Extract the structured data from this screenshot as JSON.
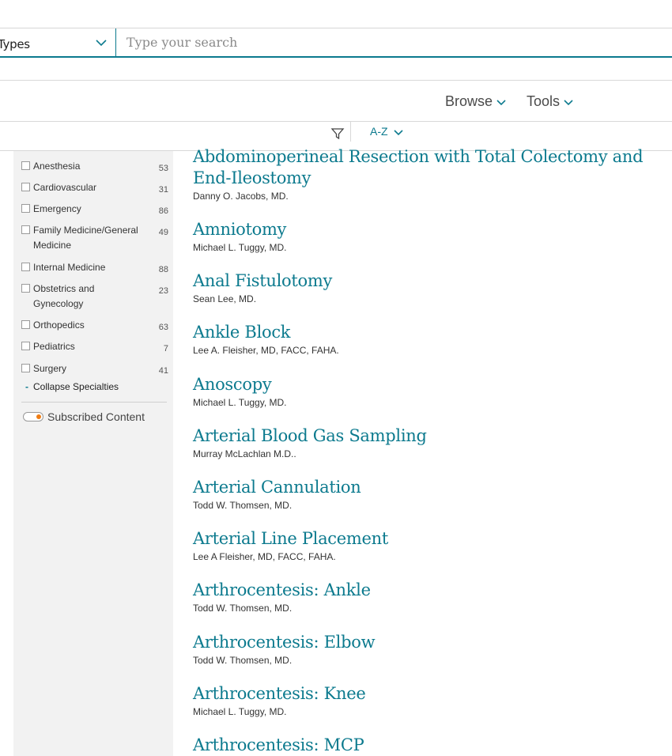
{
  "search": {
    "types_label": "Types",
    "placeholder": "Type your search"
  },
  "nav": {
    "browse": "Browse",
    "tools": "Tools"
  },
  "filter": {
    "sort_label": "A-Z"
  },
  "sidebar": {
    "specialties": [
      {
        "label": "Anesthesia",
        "count": "53"
      },
      {
        "label": "Cardiovascular",
        "count": "31"
      },
      {
        "label": "Emergency",
        "count": "86"
      },
      {
        "label": "Family Medicine/General Medicine",
        "count": "49"
      },
      {
        "label": "Internal Medicine",
        "count": "88"
      },
      {
        "label": "Obstetrics and Gynecology",
        "count": "23"
      },
      {
        "label": "Orthopedics",
        "count": "63"
      },
      {
        "label": "Pediatrics",
        "count": "7"
      },
      {
        "label": "Surgery",
        "count": "41"
      }
    ],
    "collapse_label": "Collapse Specialties",
    "subscribed_label": "Subscribed Content"
  },
  "results": [
    {
      "title": "Abdominoperineal Resection with Total Colectomy and End-Ileostomy",
      "author": "Danny O. Jacobs, MD."
    },
    {
      "title": "Amniotomy",
      "author": "Michael L. Tuggy, MD."
    },
    {
      "title": "Anal Fistulotomy",
      "author": "Sean Lee, MD."
    },
    {
      "title": "Ankle Block",
      "author": "Lee A. Fleisher, MD, FACC, FAHA."
    },
    {
      "title": "Anoscopy",
      "author": "Michael L. Tuggy, MD."
    },
    {
      "title": "Arterial Blood Gas Sampling",
      "author": "Murray McLachlan M.D.."
    },
    {
      "title": "Arterial Cannulation",
      "author": "Todd W. Thomsen, MD."
    },
    {
      "title": "Arterial Line Placement",
      "author": "Lee A Fleisher, MD, FACC, FAHA."
    },
    {
      "title": "Arthrocentesis: Ankle",
      "author": "Todd W. Thomsen, MD."
    },
    {
      "title": "Arthrocentesis: Elbow",
      "author": "Todd W. Thomsen, MD."
    },
    {
      "title": "Arthrocentesis: Knee",
      "author": "Michael L. Tuggy, MD."
    },
    {
      "title": "Arthrocentesis: MCP",
      "author": ""
    }
  ],
  "colors": {
    "accent": "#0c7a8e",
    "toggle_knob": "#f07d13"
  }
}
